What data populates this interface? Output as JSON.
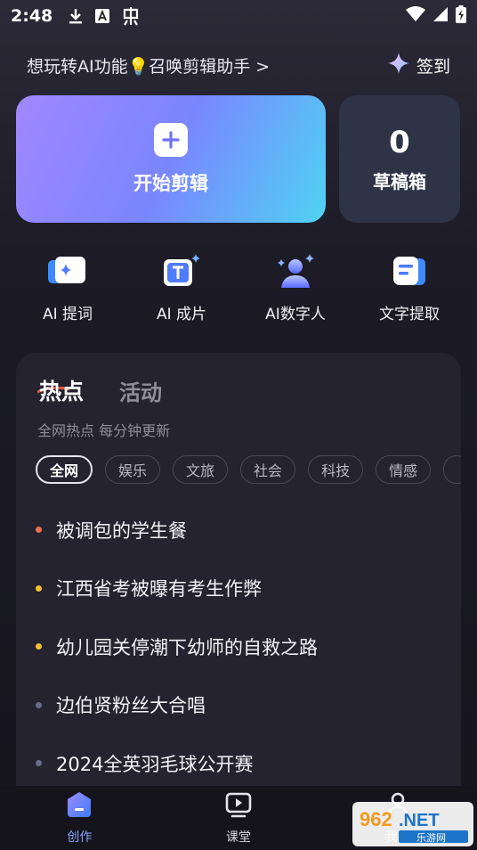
{
  "status_bar": {
    "time": "2:48"
  },
  "banner": {
    "text": "想玩转AI功能💡召唤剪辑助手 >",
    "checkin_label": "签到"
  },
  "start_card": {
    "label": "开始剪辑"
  },
  "draft_card": {
    "count": "0",
    "label": "草稿箱"
  },
  "tools": [
    {
      "label": "AI 提词",
      "icon": "ai-prompter-icon"
    },
    {
      "label": "AI 成片",
      "icon": "ai-video-icon"
    },
    {
      "label": "AI数字人",
      "icon": "ai-avatar-icon"
    },
    {
      "label": "文字提取",
      "icon": "text-extract-icon"
    }
  ],
  "panel": {
    "tab_hot": "热点",
    "tab_activity": "活动",
    "subtitle": "全网热点 每分钟更新",
    "chips": [
      "全网",
      "娱乐",
      "文旅",
      "社会",
      "科技",
      "情感"
    ],
    "items": [
      {
        "text": "被调包的学生餐",
        "dot_color": "#e8734a"
      },
      {
        "text": "江西省考被曝有考生作弊",
        "dot_color": "#f2c230"
      },
      {
        "text": "幼儿园关停潮下幼师的自救之路",
        "dot_color": "#f2c230"
      },
      {
        "text": "边伯贤粉丝大合唱",
        "dot_color": "#6a6b86"
      },
      {
        "text": "2024全英羽毛球公开赛",
        "dot_color": "#6a6b86"
      }
    ]
  },
  "bottom_nav": [
    {
      "label": "创作",
      "icon": "create-icon"
    },
    {
      "label": "课堂",
      "icon": "classroom-icon"
    },
    {
      "label": "我的",
      "icon": "profile-icon"
    }
  ],
  "watermark": {
    "brand": "962.NET",
    "sub": "乐游网"
  },
  "colors": {
    "accent": "#8aa4ff",
    "gradient_start": "#a187ff",
    "gradient_end": "#4fd3f3"
  }
}
